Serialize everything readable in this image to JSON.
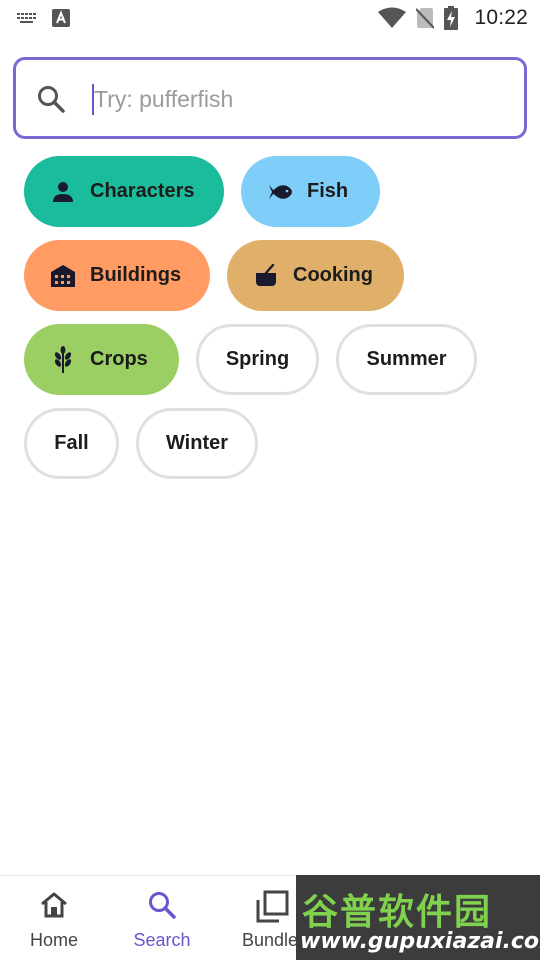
{
  "status_bar": {
    "time": "10:22",
    "icons": [
      "keyboard-icon",
      "a-notification-icon",
      "wifi-icon",
      "no-sim-icon",
      "battery-charging-icon"
    ]
  },
  "search": {
    "placeholder": "Try: pufferfish",
    "value": "",
    "accent_color": "#7b68d4"
  },
  "chips": [
    {
      "label": "Characters",
      "icon": "person-icon",
      "color": "#1abc9c",
      "selected": true
    },
    {
      "label": "Fish",
      "icon": "fish-icon",
      "color": "#7fcefa",
      "selected": true
    },
    {
      "label": "Buildings",
      "icon": "building-icon",
      "color": "#ff9b63",
      "selected": true
    },
    {
      "label": "Cooking",
      "icon": "cooking-pot-icon",
      "color": "#e0b06a",
      "selected": true
    },
    {
      "label": "Crops",
      "icon": "wheat-icon",
      "color": "#9bcf64",
      "selected": true
    },
    {
      "label": "Spring",
      "icon": null,
      "color": "#ffffff",
      "selected": false
    },
    {
      "label": "Summer",
      "icon": null,
      "color": "#ffffff",
      "selected": false
    },
    {
      "label": "Fall",
      "icon": null,
      "color": "#ffffff",
      "selected": false
    },
    {
      "label": "Winter",
      "icon": null,
      "color": "#ffffff",
      "selected": false
    }
  ],
  "bottom_nav": {
    "items": [
      {
        "label": "Home",
        "icon": "home-icon",
        "active": false
      },
      {
        "label": "Search",
        "icon": "search-icon",
        "active": true
      },
      {
        "label": "Bundle",
        "icon": "bundle-icon",
        "active": false
      }
    ],
    "active_color": "#6b55cf"
  },
  "watermark": {
    "title": "谷普软件园",
    "url": "www.gupuxiazai.com"
  }
}
